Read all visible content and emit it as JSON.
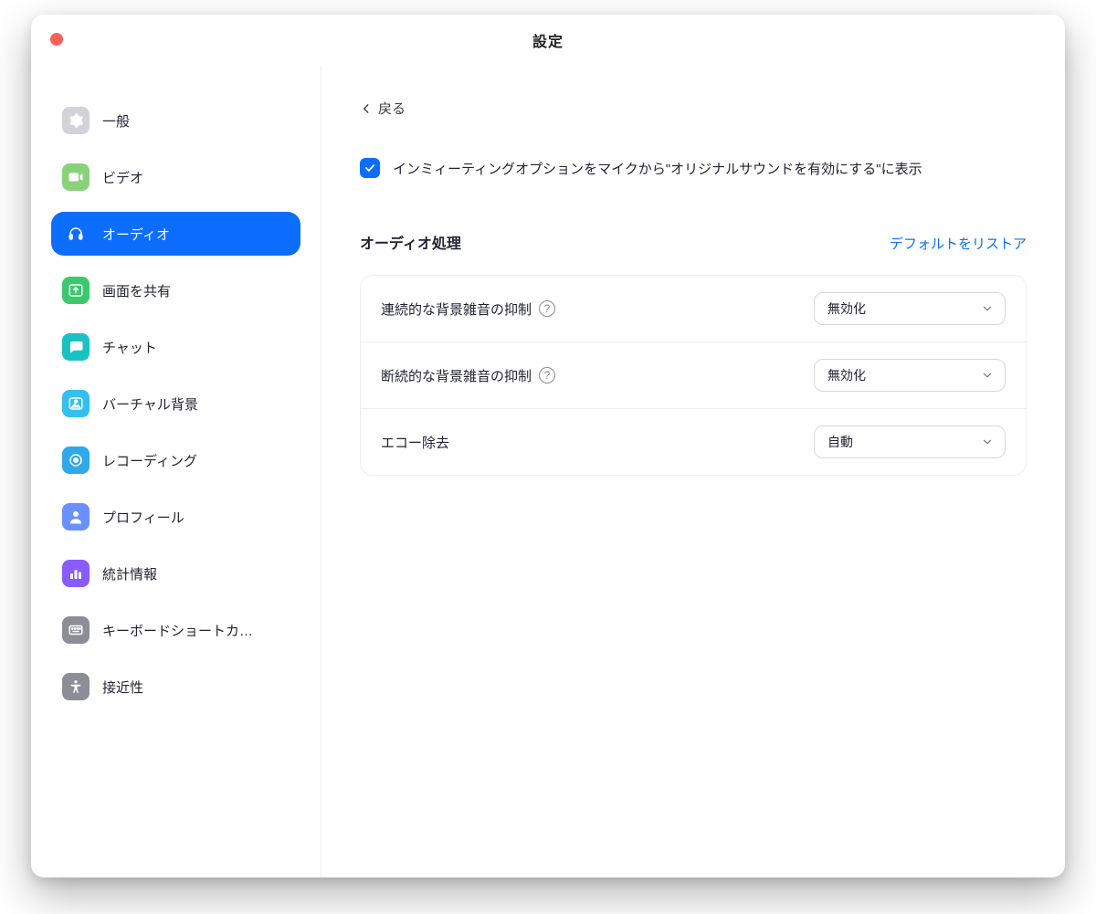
{
  "window": {
    "title": "設定"
  },
  "sidebar": {
    "items": [
      {
        "label": "一般",
        "icon": "gear",
        "icon_bg": "#d2d2d8"
      },
      {
        "label": "ビデオ",
        "icon": "video",
        "icon_bg": "#8ad27a"
      },
      {
        "label": "オーディオ",
        "icon": "headphones",
        "icon_bg": "#0d6efd",
        "active": true
      },
      {
        "label": "画面を共有",
        "icon": "share",
        "icon_bg": "#3cc96d"
      },
      {
        "label": "チャット",
        "icon": "chat",
        "icon_bg": "#19c2c2"
      },
      {
        "label": "バーチャル背景",
        "icon": "image",
        "icon_bg": "#33bff0"
      },
      {
        "label": "レコーディング",
        "icon": "record",
        "icon_bg": "#2fa9e8"
      },
      {
        "label": "プロフィール",
        "icon": "user",
        "icon_bg": "#6a8fff"
      },
      {
        "label": "統計情報",
        "icon": "stats",
        "icon_bg": "#8a5bff"
      },
      {
        "label": "キーボードショートカ…",
        "icon": "keyboard",
        "icon_bg": "#8d8d97"
      },
      {
        "label": "接近性",
        "icon": "accessibility",
        "icon_bg": "#8d8d97"
      }
    ]
  },
  "main": {
    "back_label": "戻る",
    "checkbox_checked": true,
    "checkbox_label": "インミィーティングオプションをマイクから\"オリジナルサウンドを有効にする\"に表示",
    "section_title": "オーディオ処理",
    "restore_label": "デフォルトをリストア",
    "rows": [
      {
        "label": "連続的な背景雑音の抑制",
        "help": true,
        "value": "無効化"
      },
      {
        "label": "断続的な背景雑音の抑制",
        "help": true,
        "value": "無効化"
      },
      {
        "label": "エコー除去",
        "help": false,
        "value": "自動"
      }
    ]
  }
}
